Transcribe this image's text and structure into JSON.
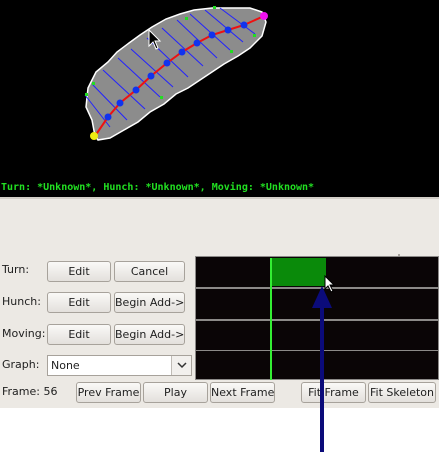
{
  "status": {
    "text": "Turn: *Unknown*, Hunch: *Unknown*, Moving: *Unknown*"
  },
  "rows": [
    {
      "id": "turn",
      "label": "Turn:",
      "left_button": "Edit",
      "right_button": "Cancel"
    },
    {
      "id": "hunch",
      "label": "Hunch:",
      "left_button": "Edit",
      "right_button": "Begin Add->"
    },
    {
      "id": "moving",
      "label": "Moving:",
      "left_button": "Edit",
      "right_button": "Begin Add->"
    }
  ],
  "graph": {
    "label": "Graph:",
    "selected": "None"
  },
  "frame": {
    "label": "Frame: 56"
  },
  "buttons": {
    "prev_frame": "Prev Frame",
    "play": "Play",
    "next_frame": "Next Frame",
    "fit_frame": "Fit Frame",
    "fit_skeleton": "Fit Skeleton"
  },
  "colors": {
    "status_text": "#22e022",
    "track_fill": "#0a8a0a",
    "playhead": "#33ee33",
    "spine": "#ee1111",
    "spine_points": "#1133ee",
    "worm_body": "#8c8c8c",
    "head_marker": "#ee11ee",
    "tail_marker": "#eeee11",
    "annotation_arrow": "#0b0b7a"
  },
  "icons": {
    "select_arrow": "chevron-down-icon",
    "cursor": "mouse-pointer-icon",
    "annotation": "up-arrow-icon"
  }
}
